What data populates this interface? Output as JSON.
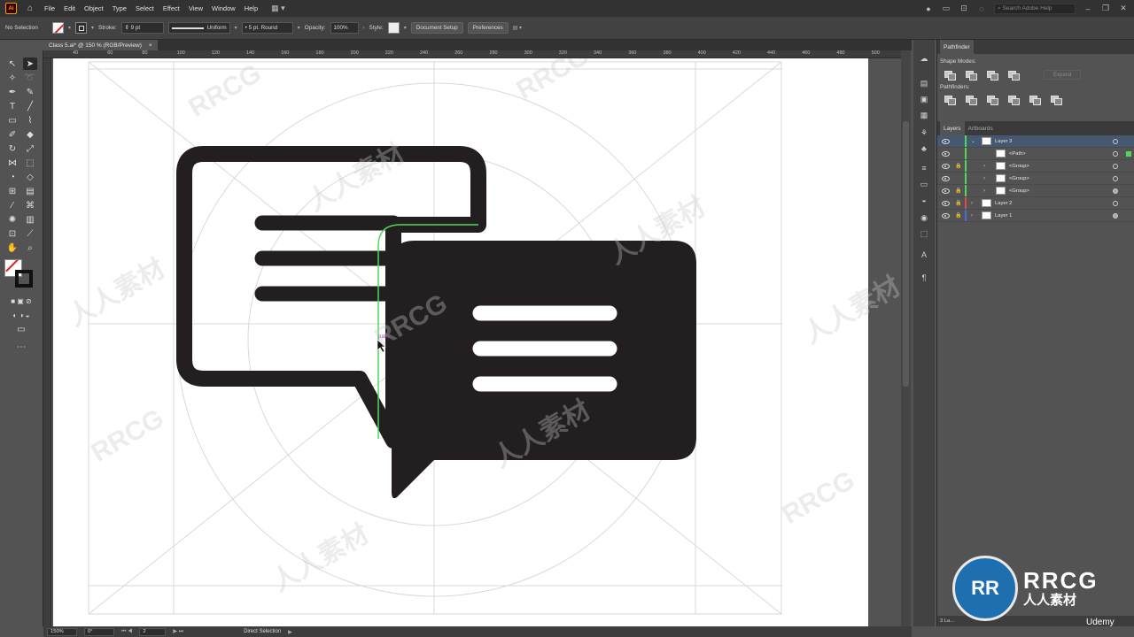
{
  "menubar": {
    "app_logo": "Ai",
    "items": [
      "File",
      "Edit",
      "Object",
      "Type",
      "Select",
      "Effect",
      "View",
      "Window",
      "Help"
    ],
    "search_placeholder": "Search Adobe Help"
  },
  "control_bar": {
    "selection": "No Selection",
    "stroke_label": "Stroke:",
    "stroke_weight": "9 pt",
    "profile": "Uniform",
    "brush": "5 pt. Round",
    "opacity_label": "Opacity:",
    "opacity_value": "100%",
    "style_label": "Style:",
    "doc_setup": "Document Setup",
    "preferences": "Preferences"
  },
  "document_tab": {
    "title": "Class 5.ai* @ 150 % (RGB/Preview)",
    "close": "×"
  },
  "ruler": {
    "ticks": [
      "40",
      "60",
      "80",
      "100",
      "120",
      "140",
      "160",
      "180",
      "200",
      "220",
      "240",
      "260",
      "280",
      "300",
      "320",
      "340",
      "360",
      "380",
      "400",
      "420",
      "440",
      "460",
      "480",
      "500"
    ]
  },
  "canvas": {
    "hover_label": "path"
  },
  "status": {
    "zoom": "150%",
    "rotation": "0°",
    "artboard": "2",
    "tool": "Direct Selection"
  },
  "pathfinder": {
    "tab": "Pathfinder",
    "shape_modes": "Shape Modes:",
    "pathfinders": "Pathfinders:",
    "expand": "Expand"
  },
  "layers": {
    "tab_layers": "Layers",
    "tab_artboards": "Artboards",
    "footer": "3 La...",
    "rows": [
      {
        "name": "Layer 3",
        "color": "#4fd85a"
      },
      {
        "name": "<Path>",
        "color": "#4fd85a"
      },
      {
        "name": "<Group>",
        "color": "#4fd85a"
      },
      {
        "name": "<Group>",
        "color": "#4fd85a"
      },
      {
        "name": "<Group>",
        "color": "#4fd85a"
      },
      {
        "name": "Layer 2",
        "color": "#e04a4a"
      },
      {
        "name": "Layer 1",
        "color": "#4a6ae0"
      }
    ]
  },
  "watermarks": [
    "RRCG",
    "人人素材"
  ],
  "brand": {
    "logo_top": "RRCG",
    "logo_bottom": "人人素材",
    "udemy": "Udemy"
  },
  "colors": {
    "icon_fill": "#231f20",
    "selection_path": "#4fd85a"
  }
}
